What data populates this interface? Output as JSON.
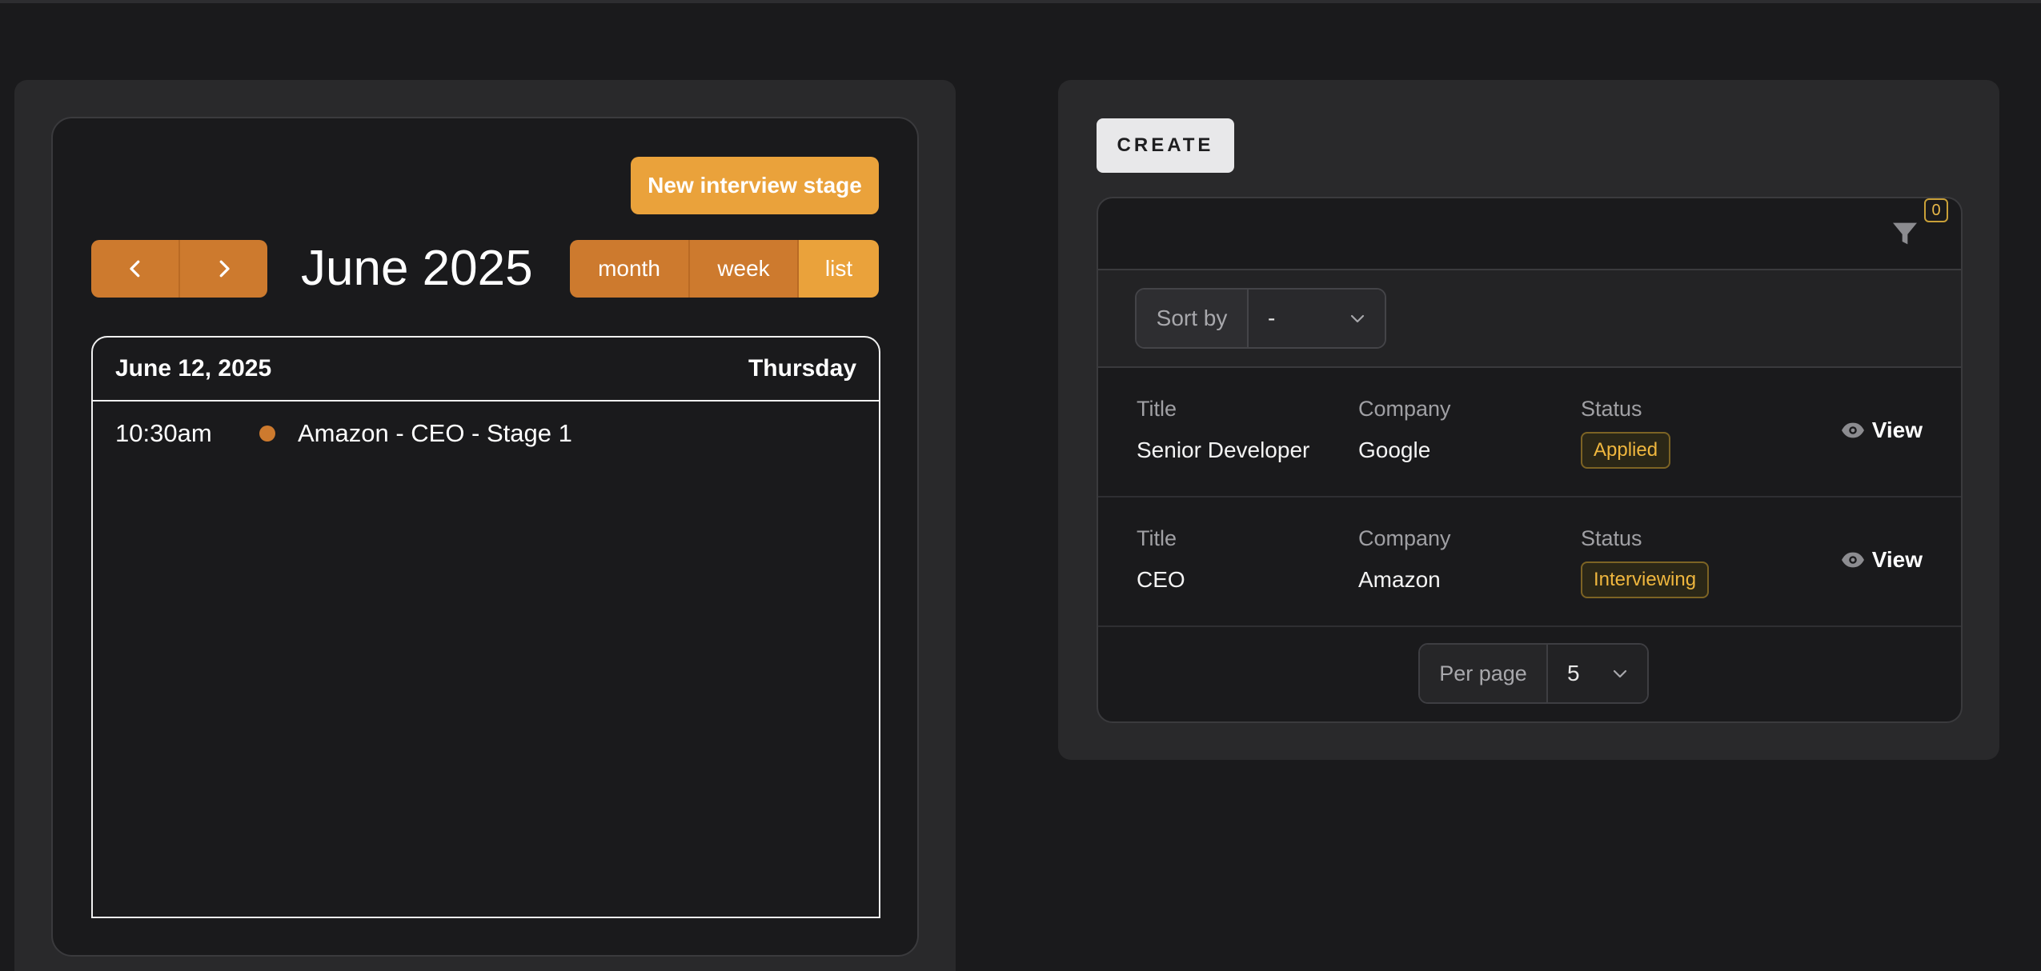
{
  "calendar": {
    "new_stage_label": "New interview stage",
    "title": "June 2025",
    "prev_icon": "chevron-left-icon",
    "next_icon": "chevron-right-icon",
    "views": {
      "month": "month",
      "week": "week",
      "list": "list"
    },
    "active_view": "list",
    "list": {
      "date": "June 12, 2025",
      "day": "Thursday",
      "events": [
        {
          "time": "10:30am",
          "title": "Amazon - CEO - Stage 1"
        }
      ]
    },
    "accent": "#cd7a2e",
    "accent_active": "#eaa23b"
  },
  "jobs": {
    "create_label": "CREATE",
    "filter_icon": "filter-icon",
    "filter_count": "0",
    "sort": {
      "label": "Sort by",
      "value": "-"
    },
    "columns": {
      "title": "Title",
      "company": "Company",
      "status": "Status"
    },
    "rows": [
      {
        "title": "Senior Developer",
        "company": "Google",
        "status": "Applied",
        "action": "View"
      },
      {
        "title": "CEO",
        "company": "Amazon",
        "status": "Interviewing",
        "action": "View"
      }
    ],
    "pagination": {
      "label": "Per page",
      "value": "5"
    },
    "status_color": "#f0b73e"
  }
}
